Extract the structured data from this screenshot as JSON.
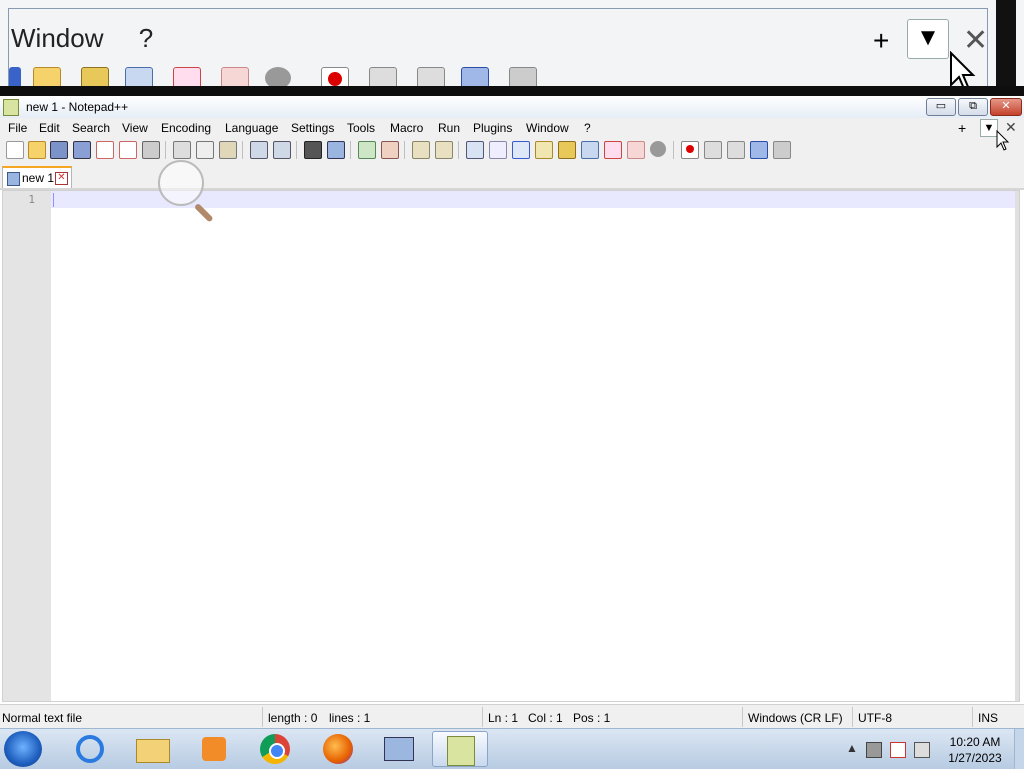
{
  "magnifier": {
    "menu": [
      "Window",
      "?"
    ],
    "plus": "+",
    "dropdown": "▼",
    "close": "✕"
  },
  "window": {
    "title": "new 1 - Notepad++",
    "min": "▭",
    "max": "⧉",
    "close": "✕"
  },
  "menu": {
    "items": [
      "File",
      "Edit",
      "Search",
      "View",
      "Encoding",
      "Language",
      "Settings",
      "Tools",
      "Macro",
      "Run",
      "Plugins",
      "Window",
      "?"
    ],
    "plus": "+",
    "dropdown": "▼",
    "close": "✕"
  },
  "tabs": [
    {
      "label": "new 1",
      "close": "✕"
    }
  ],
  "editor": {
    "line_numbers": [
      "1"
    ]
  },
  "status": {
    "file_type": "Normal text file",
    "length": "length : 0",
    "lines": "lines : 1",
    "ln": "Ln : 1",
    "col": "Col : 1",
    "pos": "Pos : 1",
    "eol": "Windows (CR LF)",
    "encoding": "UTF-8",
    "mode": "INS"
  },
  "taskbar": {
    "apps": [
      "start-button",
      "internet-explorer",
      "file-explorer",
      "media-player",
      "chrome",
      "firefox",
      "network-app",
      "notepad-plus-plus"
    ],
    "time": "10:20 AM",
    "date": "1/27/2023",
    "tray_arrow": "▲"
  }
}
